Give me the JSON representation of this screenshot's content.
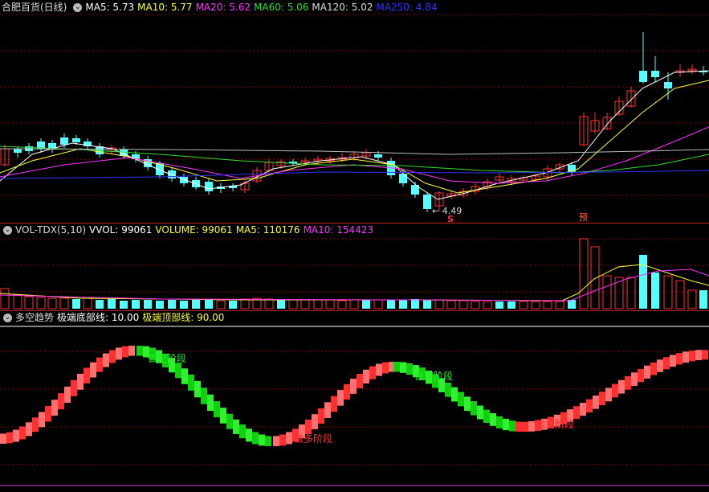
{
  "main": {
    "title": "合肥百货(日线)",
    "ma": [
      {
        "label": "MA5: 5.73",
        "color": "#ffffff"
      },
      {
        "label": "MA10: 5.77",
        "color": "#ffff33"
      },
      {
        "label": "MA20: 5.62",
        "color": "#ff33ff"
      },
      {
        "label": "MA60: 5.06",
        "color": "#33dd33"
      },
      {
        "label": "MA120: 5.02",
        "color": "#dddddd"
      },
      {
        "label": "MA250: 4.84",
        "color": "#3333ff"
      }
    ],
    "low_label": "4.49",
    "marker_s": "S",
    "marker_yu": "预"
  },
  "vol": {
    "title": "VOL-TDX(5,10)",
    "items": [
      {
        "label": "VVOL: 99061",
        "color": "#ffffff"
      },
      {
        "label": "VOLUME: 99061",
        "color": "#ffff33"
      },
      {
        "label": "MA5: 110176",
        "color": "#ffff33"
      },
      {
        "label": "MA10: 154423",
        "color": "#ff33ff"
      }
    ]
  },
  "trend": {
    "title": "多空趋势",
    "items": [
      {
        "label": "极端底部线: 10.00",
        "color": "#ffffff"
      },
      {
        "label": "极端顶部线: 90.00",
        "color": "#ffff33"
      }
    ],
    "labels": {
      "short1": "做空阶段",
      "long1": "做多阶段",
      "short2": "做空阶段",
      "long2": "做多阶段"
    }
  },
  "colors": {
    "up": "#ff3333",
    "down": "#54ffff",
    "grid": "#8b0000",
    "red": "#ff2020",
    "green": "#10e010"
  }
}
